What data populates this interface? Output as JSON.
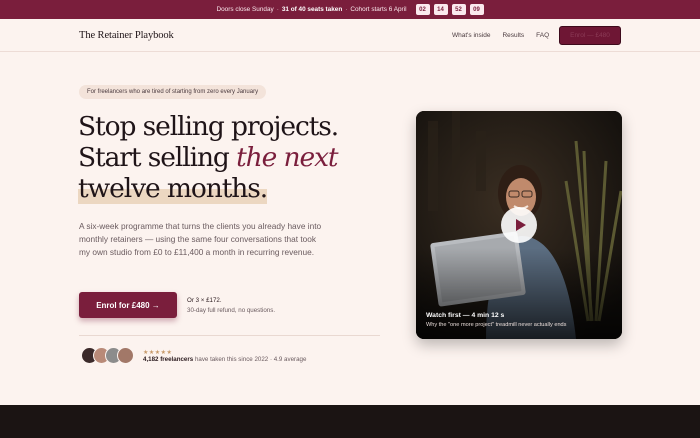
{
  "announcement": {
    "doors": "Doors close Sunday",
    "seats": "31 of 40 seats taken",
    "cohort": "Cohort starts 6 April",
    "countdown": [
      "02",
      "14",
      "52",
      "09"
    ]
  },
  "nav": {
    "logo": "The Retainer Playbook",
    "links": [
      "What's inside",
      "Results",
      "FAQ"
    ],
    "cta_prefix": "Enrol —",
    "cta_price": "£480"
  },
  "hero": {
    "pill": "For freelancers who are tired of starting from zero every January",
    "headline_line1": "Stop selling projects.",
    "headline_line2_start": "Start selling ",
    "headline_line2_em": "the next",
    "headline_line3": "twelve months.",
    "lead": "A six-week programme that turns the clients you already have into monthly retainers — using the same four conversations that took my own studio from £0 to £11,400 a month in recurring revenue.",
    "cta_label": "Enrol for £480 →",
    "installments": "Or 3 × £172.",
    "refund": "30-day full refund, no questions.",
    "stars": "★★★★★",
    "proof_count": "4,182 freelancers",
    "proof_rest": " have taken this since 2022 · 4.9 average"
  },
  "video": {
    "title": "Watch first — 4 min 12 s",
    "subtitle": "Why the \"one more project\" treadmill never actually ends",
    "play_icon": "play-icon"
  },
  "colors": {
    "brand": "#7a1e3c",
    "background": "#fcf3ef",
    "highlight": "#ecd7c1"
  }
}
